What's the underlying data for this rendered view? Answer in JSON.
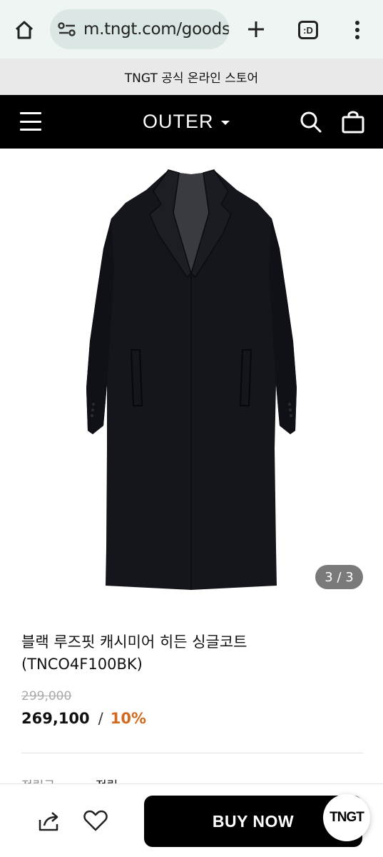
{
  "browser": {
    "url": "m.tngt.com/goods/",
    "tabs_label": ":D",
    "icons": [
      "home-icon",
      "site-settings-icon",
      "new-tab-icon",
      "tab-switcher-icon",
      "more-vert-icon"
    ]
  },
  "announcement": "TNGT 공식 온라인 스토어",
  "header": {
    "category": "OUTER",
    "icons": [
      "menu-icon",
      "search-icon",
      "shopping-bag-icon"
    ]
  },
  "gallery": {
    "counter": "3 / 3"
  },
  "product": {
    "name_line1": "블랙 루즈핏 캐시미어 히든 싱글코트",
    "name_line2": "(TNCO4F100BK)",
    "original_price": "299,000",
    "sale_price": "269,100",
    "separator": "/",
    "discount": "10%",
    "partial_row_label": "적립금",
    "partial_row_value": "적립"
  },
  "bottom_bar": {
    "buy_label": "BUY NOW",
    "brand_badge": "TNGT",
    "icons": [
      "share-icon",
      "heart-icon"
    ]
  },
  "colors": {
    "browser_bg": "#eef5f3",
    "url_pill": "#dbe7e4",
    "announcement_bg": "#e9e9e9",
    "header_bg": "#000000",
    "discount": "#d2691e",
    "counter_bg": "#7a7a7a"
  }
}
